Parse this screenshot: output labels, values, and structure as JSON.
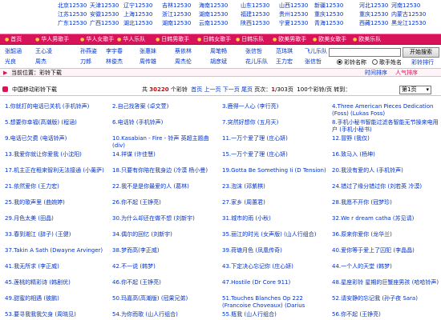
{
  "regions": [
    [
      "北京12530",
      "天津12530",
      "辽宁12530",
      "吉林12530",
      "海南12530",
      "山东12530",
      "山西12530",
      "新疆12530",
      "河北12530",
      "河南12530"
    ],
    [
      "江苏12530",
      "安徽12530",
      "上海12530",
      "浙江12530",
      "湖南12530",
      "福建12530",
      "贵州12530",
      "重庆12530",
      "重庆12530",
      "内蒙古12530"
    ],
    [
      "广东12530",
      "广西12530",
      "湖北12530",
      "湖南12530",
      "云南12530",
      "陕西12530",
      "宁夏12530",
      "青海12530",
      "西藏12530",
      "黑龙江12530"
    ]
  ],
  "nav": [
    "首页",
    "华人男歌手",
    "华人女歌手",
    "华人乐队",
    "日韩男歌手",
    "日韩女歌手",
    "日韩乐队",
    "欧美男歌手",
    "欧美女歌手",
    "欧美乐队"
  ],
  "singers_row1": [
    "张韶涵",
    "王心凌",
    "孙燕姿",
    "李宇春",
    "张惠妹",
    "蔡依林",
    "周笔畅",
    "张信哲",
    "范玮琪",
    "飞儿乐队"
  ],
  "singers_row2": [
    "光良",
    "周杰",
    "刀郎",
    "林俊杰",
    "周传雄",
    "周杰伦",
    "胡彦斌",
    "花儿乐队",
    "王力宏",
    "张信哲"
  ],
  "search": {
    "placeholder": "",
    "value": "",
    "button": "开始搜索"
  },
  "search_options": [
    {
      "label": "彩铃名称",
      "checked": true
    },
    {
      "label": "歌手姓名",
      "checked": false
    }
  ],
  "charts_link": "彩铃排行",
  "breadcrumb": {
    "current": "当前位置：彩铃下载",
    "sort_time": "时间排序",
    "sort_hot": "人气排序"
  },
  "list": {
    "title": "中国移动彩铃下载",
    "total_prefix": "共",
    "total": "30220",
    "total_suffix": "个彩铃",
    "first": "首页",
    "prev": "上一页",
    "next": "下一页",
    "last": "尾页",
    "page_label": "页次：",
    "page_cur": "1",
    "page_total": "/303页",
    "per_page": "100个彩铃/页",
    "goto": "转到：",
    "page_option": "第1页"
  },
  "songs": [
    "1.你就打的电话已关机 (手机铃声)",
    "2.自己找答案 (卓文萱)",
    "3.鹿得一人心 (李行亮)",
    "4.Three American Pieces Dedication (Foss) (Lukas Foss)",
    "5.想要你幸福(高潮版) (程涵)",
    "6.电话铃 (手机铃声)",
    "7.突然好想你 (五月天)",
    "8.手机小秘书智能过滤各智能无节操来电用户 (手机小秘书)",
    "9.电话已欠费 (电话铃声)",
    "10.Kasabian - Fire - 铃声 英超主题曲 (div)",
    "11.一万个爱了理 (庄心妍)",
    "12.冒野 (我仅)",
    "13.我爱你就让你爱我 (小沈阳)",
    "14.祥谋 (许佳慧)",
    "15.一万个爱了理 (庄心妍)",
    "16.致马入 (杨坤)",
    "17.机主正在租来智利无法接通 (小薰萨)",
    "18.只要有你陪在我身边 (冷漠 杨小曼)",
    "19.Gotta Be Something Ii (D Tension)",
    "20.我没有爱的人 (手机铃声)",
    "21.依然爱你 (王力宏)",
    "22.我不是是你最爱的人 (葛林)",
    "23.泡沫 (邓紫棋)",
    "24.错过了缘分错过你 (刘若英 冷漠)",
    "25.我的歌声里 (曲婉婷)",
    "26.你不起 (王铮亮)",
    "27.家乡 (周蕙君)",
    "28.我愿不开你 (冠梦珍)",
    "29.月色太美 (田晶)",
    "30.为什么却还在做不想 (刘新宇)",
    "31.城市的雨 (小秋)",
    "32.We r dream catha (苏见请)",
    "33.春到湘江 (辞子) (王健)",
    "34.偶尔的回忆 (刘新宇)",
    "35.丽江的时光 (女声版) (山人行组合)",
    "36.原来你爱你 (龙华兰)",
    "37.Takin A Sath (Dwayne Arvinger)",
    "38.梦而高(李正威)",
    "39.荷塘月色 (凤凰传奇)",
    "40.爱你等于爱上了囚犯 (李晶晶)",
    "41.我无所求 (李正威)",
    "42.不一说 (韩梦)",
    "43.下定决心忘记你 (庄心妍)",
    "44.一个人的天堂 (韩梦)",
    "45.莲桃的精彩诗 (韩剧优)",
    "46.你不起 (王铮亮)",
    "47.Hostile (Dr Core 911)",
    "48.星座彩铃 星期的巨蟹座男孩 (哈哈铃声)",
    "49.甜蜜的相遇 (彼鹏)",
    "50.玛嘉高(高潮版) (冠果兄弟)",
    "51.Touches Blanches Op 222 (Francoise Choveaux) (Darius Milhaud)",
    "52.请安静的忘记我 (孙子夜 Sara)",
    "53.要寻我我我欠身 (周晓见)",
    "54.为你而歌 (山人行组合)",
    "55.瓶我 (山人行组合)",
    "56.你不起 (王铮亮)",
    "57.康乃碧 (刘馨)",
    "58.拥连丽碧律落分(长笛) (上海乐团管弦乐队)",
    "59.江南Style (PSY)",
    "60.Roll On (As Made Famous By Kid Rock) (Future Hit Makers Of America)"
  ]
}
